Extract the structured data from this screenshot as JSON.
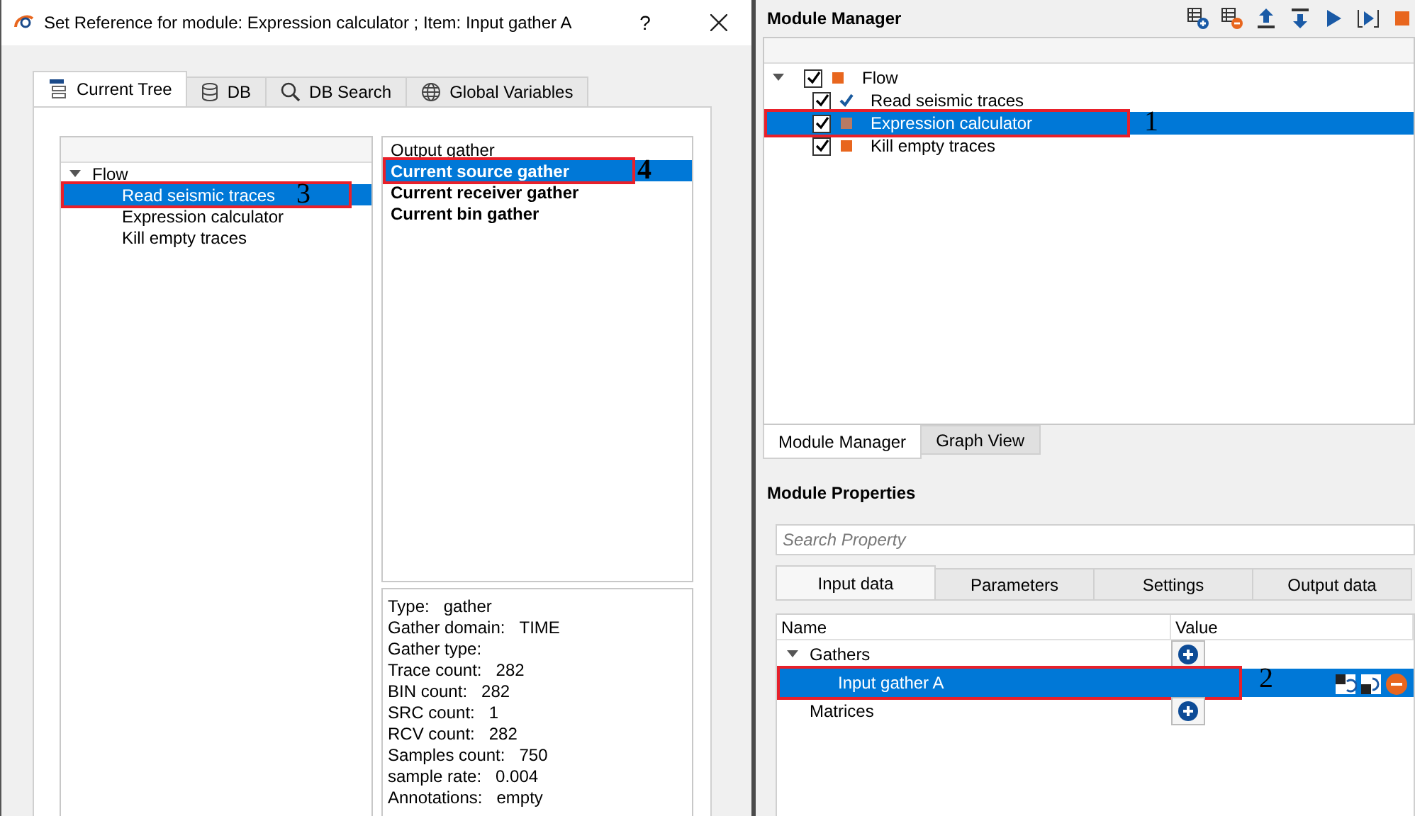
{
  "dialog": {
    "title": "Set Reference for module: Expression calculator ; Item: Input gather A",
    "help": "?",
    "tabs": [
      {
        "label": "Current Tree",
        "selected": true
      },
      {
        "label": "DB",
        "selected": false
      },
      {
        "label": "DB Search",
        "selected": false
      },
      {
        "label": "Global Variables",
        "selected": false
      }
    ],
    "tree": {
      "root": {
        "label": "Flow",
        "expanded": true,
        "children": [
          {
            "label": "Read seismic traces",
            "selected": true,
            "marker": "3"
          },
          {
            "label": "Expression calculator",
            "selected": false
          },
          {
            "label": "Kill empty traces",
            "selected": false
          }
        ]
      }
    },
    "gathers": [
      {
        "label": "Output gather",
        "bold": false,
        "selected": false
      },
      {
        "label": "Current source gather",
        "bold": true,
        "selected": true,
        "marker": "4"
      },
      {
        "label": "Current receiver gather",
        "bold": true,
        "selected": false
      },
      {
        "label": "Current bin gather",
        "bold": true,
        "selected": false
      }
    ],
    "info": [
      {
        "label": "Type:",
        "value": "gather"
      },
      {
        "label": "Gather domain:",
        "value": "TIME"
      },
      {
        "label": "Gather type:"
      },
      {
        "label": "Trace count:",
        "value": "282"
      },
      {
        "label": "BIN count:",
        "value": "282"
      },
      {
        "label": "SRC count:",
        "value": "1"
      },
      {
        "label": "RCV count:",
        "value": "282"
      },
      {
        "label": "Samples count:",
        "value": "750"
      },
      {
        "label": "sample rate:",
        "value": "0.004"
      },
      {
        "label": "Annotations:",
        "value": "empty"
      }
    ]
  },
  "module_manager": {
    "title": "Module Manager",
    "tree": {
      "root": {
        "label": "Flow",
        "expanded": true,
        "checked": true,
        "kind": "square",
        "color": "#e8661e",
        "children": [
          {
            "label": "Read seismic traces",
            "checked": true,
            "kind": "check",
            "color": "#1a5a9e",
            "selected": false
          },
          {
            "label": "Expression calculator",
            "checked": true,
            "kind": "square",
            "color": "#b87a63",
            "selected": true,
            "marker": "1"
          },
          {
            "label": "Kill empty traces",
            "checked": true,
            "kind": "square",
            "color": "#e8661e",
            "selected": false
          }
        ]
      }
    },
    "tabs": [
      {
        "label": "Module Manager",
        "selected": true
      },
      {
        "label": "Graph View",
        "selected": false
      }
    ]
  },
  "module_properties": {
    "title": "Module Properties",
    "search": {
      "placeholder": "Search Property"
    },
    "tabs": [
      {
        "label": "Input data",
        "selected": true
      },
      {
        "label": "Parameters",
        "selected": false
      },
      {
        "label": "Settings",
        "selected": false
      },
      {
        "label": "Output data",
        "selected": false
      }
    ],
    "table": {
      "columns": [
        "Name",
        "Value"
      ],
      "rows": [
        {
          "kind": "group",
          "name": "Gathers",
          "expanded": true,
          "selected": false
        },
        {
          "kind": "item",
          "name": "Input gather A",
          "selected": true,
          "marker": "2"
        },
        {
          "kind": "group",
          "name": "Matrices",
          "selected": false
        }
      ]
    }
  }
}
